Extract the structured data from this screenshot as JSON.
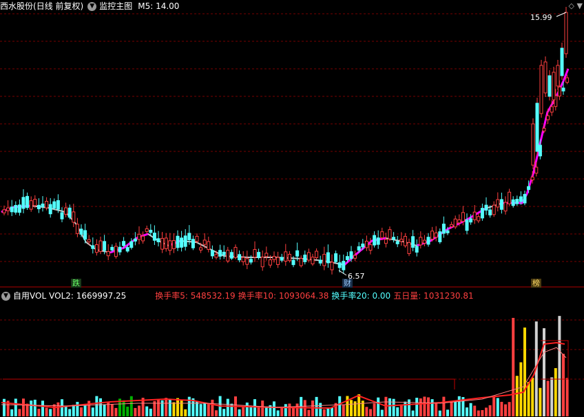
{
  "main_header": {
    "stock_name": "西水股份",
    "period": "(日线 前复权)",
    "indicator_menu": "监控主图",
    "ma_label": "M5: 14.00",
    "diamond_icon": "diamond-icon"
  },
  "annotations": {
    "high_label": "15.99",
    "low_label": "6.57",
    "marker_die": "跌",
    "marker_cai": "财",
    "marker_bang": "榜"
  },
  "sub_header": {
    "menu": "自用VOL",
    "vol2": "VOL2: 1669997.25",
    "turnover5": "换手率5: 548532.19",
    "turnover10": "换手率10: 1093064.38",
    "turnover20": "换手率20: 0.00",
    "day5_volume": "五日量: 1031230.81"
  },
  "colors": {
    "background": "#000000",
    "up_candle": "#ff4040",
    "down_candle": "#54ffff",
    "ma_up": "#ff00ff",
    "ma_flat": "#c8c8c8",
    "grid": "#7a0000",
    "vol_yellow": "#ffd700",
    "vol_green": "#00b000",
    "vol_white": "#d0d0d0",
    "text_white": "#ffffff",
    "text_red": "#ff4040",
    "text_cyan": "#54ffff"
  },
  "chart_data": {
    "type": "candlestick",
    "price_range": [
      6.57,
      15.99
    ],
    "price_high": 15.99,
    "price_low": 6.57,
    "ma5_last": 14.0,
    "volume_series": [
      {
        "name": "VOL2",
        "last": 1669997.25
      },
      {
        "name": "换手率5",
        "last": 548532.19
      },
      {
        "name": "换手率10",
        "last": 1093064.38
      },
      {
        "name": "换手率20",
        "last": 0.0
      },
      {
        "name": "五日量",
        "last": 1031230.81
      }
    ]
  }
}
